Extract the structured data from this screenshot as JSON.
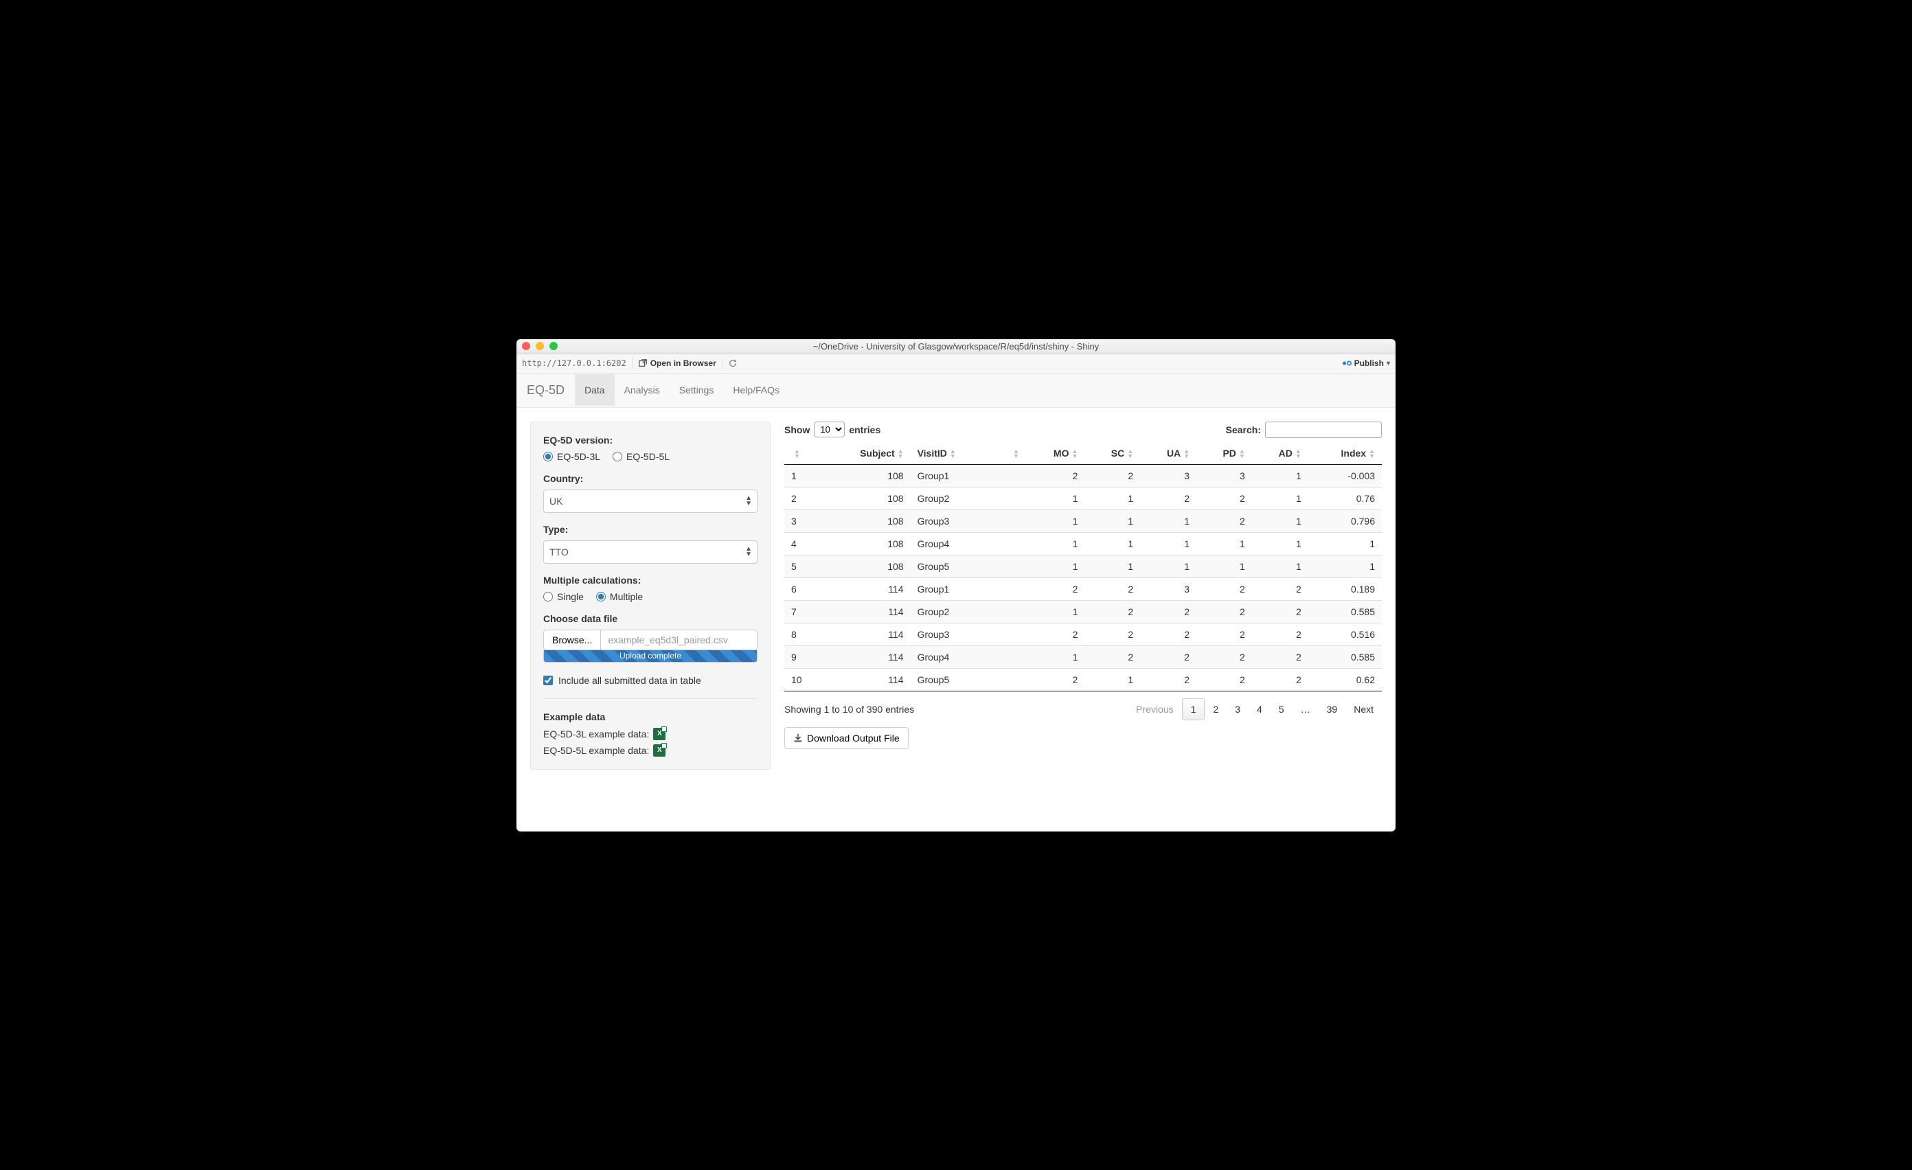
{
  "window": {
    "title": "~/OneDrive - University of Glasgow/workspace/R/eq5d/inst/shiny - Shiny",
    "url": "http://127.0.0.1:6202",
    "open_in_browser": "Open in Browser",
    "publish": "Publish"
  },
  "nav": {
    "brand": "EQ-5D",
    "tabs": [
      "Data",
      "Analysis",
      "Settings",
      "Help/FAQs"
    ],
    "active": 0
  },
  "sidebar": {
    "version_label": "EQ-5D version:",
    "version_options": [
      "EQ-5D-3L",
      "EQ-5D-5L"
    ],
    "version_selected": 0,
    "country_label": "Country:",
    "country_value": "UK",
    "type_label": "Type:",
    "type_value": "TTO",
    "multi_label": "Multiple calculations:",
    "multi_options": [
      "Single",
      "Multiple"
    ],
    "multi_selected": 1,
    "file_label": "Choose data file",
    "browse": "Browse...",
    "file_name": "example_eq5d3l_paired.csv",
    "upload_status": "Upload complete",
    "include_checkbox": "Include all submitted data in table",
    "example_heading": "Example data",
    "example_3l": "EQ-5D-3L example data:",
    "example_5l": "EQ-5D-5L example data:"
  },
  "table": {
    "show_label_pre": "Show",
    "show_label_post": "entries",
    "page_size": "10",
    "search_label": "Search:",
    "columns": [
      "",
      "Subject",
      "VisitID",
      "",
      "MO",
      "SC",
      "UA",
      "PD",
      "AD",
      "Index"
    ],
    "rows": [
      [
        "1",
        "108",
        "Group1",
        "",
        "2",
        "2",
        "3",
        "3",
        "1",
        "-0.003"
      ],
      [
        "2",
        "108",
        "Group2",
        "",
        "1",
        "1",
        "2",
        "2",
        "1",
        "0.76"
      ],
      [
        "3",
        "108",
        "Group3",
        "",
        "1",
        "1",
        "1",
        "2",
        "1",
        "0.796"
      ],
      [
        "4",
        "108",
        "Group4",
        "",
        "1",
        "1",
        "1",
        "1",
        "1",
        "1"
      ],
      [
        "5",
        "108",
        "Group5",
        "",
        "1",
        "1",
        "1",
        "1",
        "1",
        "1"
      ],
      [
        "6",
        "114",
        "Group1",
        "",
        "2",
        "2",
        "3",
        "2",
        "2",
        "0.189"
      ],
      [
        "7",
        "114",
        "Group2",
        "",
        "1",
        "2",
        "2",
        "2",
        "2",
        "0.585"
      ],
      [
        "8",
        "114",
        "Group3",
        "",
        "2",
        "2",
        "2",
        "2",
        "2",
        "0.516"
      ],
      [
        "9",
        "114",
        "Group4",
        "",
        "1",
        "2",
        "2",
        "2",
        "2",
        "0.585"
      ],
      [
        "10",
        "114",
        "Group5",
        "",
        "2",
        "1",
        "2",
        "2",
        "2",
        "0.62"
      ]
    ],
    "info": "Showing 1 to 10 of 390 entries",
    "pagination": {
      "previous": "Previous",
      "pages": [
        "1",
        "2",
        "3",
        "4",
        "5",
        "…",
        "39"
      ],
      "next": "Next",
      "active": 0
    },
    "download": "Download Output File"
  }
}
